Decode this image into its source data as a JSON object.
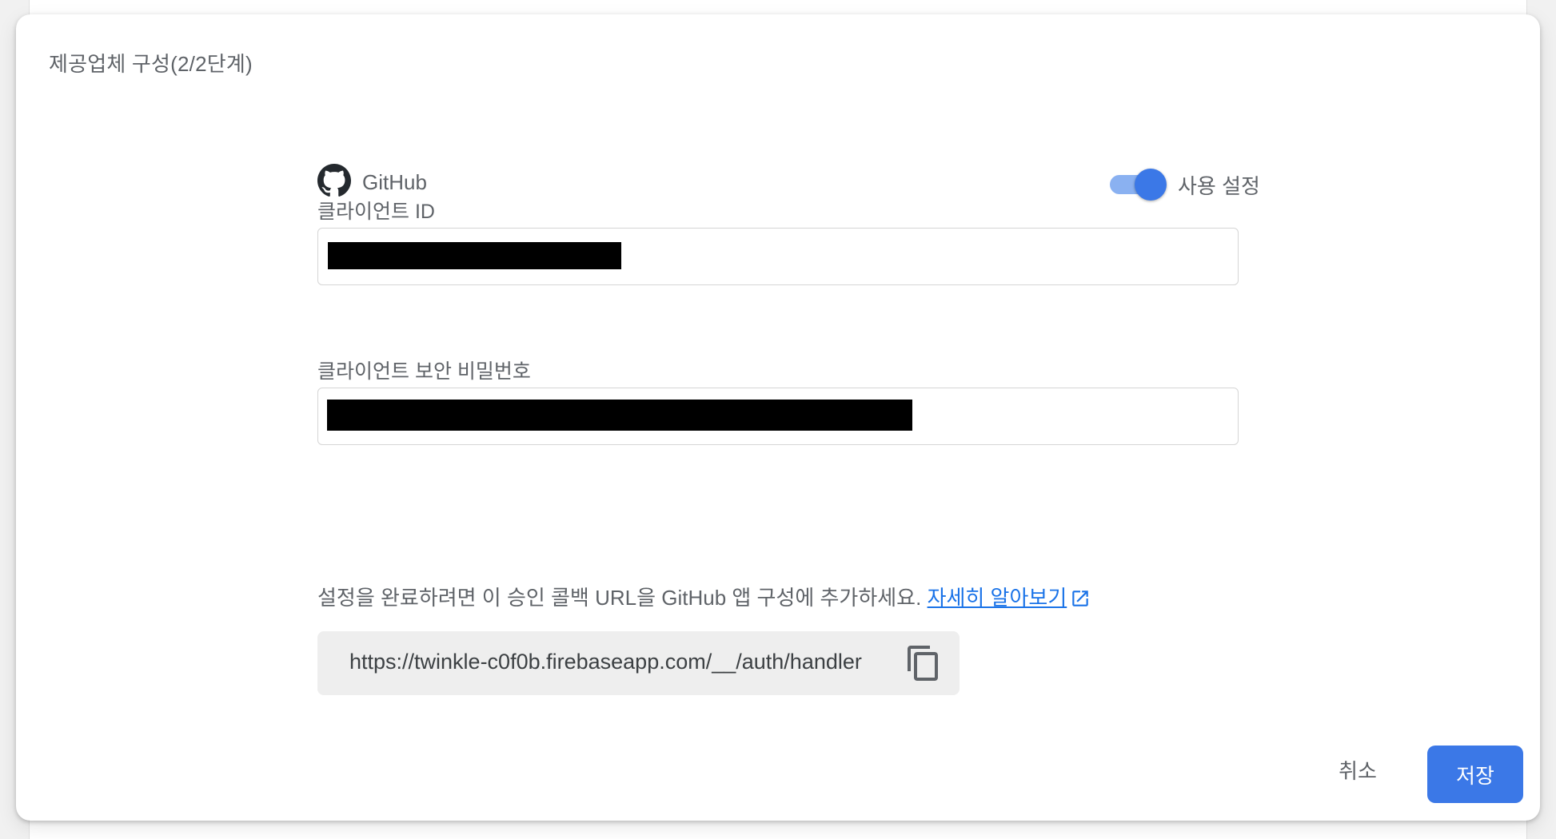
{
  "dialog": {
    "title": "제공업체 구성(2/2단계)"
  },
  "provider": {
    "icon": "github-icon",
    "name": "GitHub",
    "enabled": true,
    "toggle_label": "사용 설정"
  },
  "fields": {
    "client_id_label": "클라이언트 ID",
    "client_secret_label": "클라이언트 보안 비밀번호"
  },
  "callback": {
    "note": "설정을 완료하려면 이 승인 콜백 URL을 GitHub 앱 구성에 추가하세요.",
    "learn_more": "자세히 알아보기",
    "url": "https://twinkle-c0f0b.firebaseapp.com/__/auth/handler"
  },
  "actions": {
    "cancel": "취소",
    "save": "저장"
  },
  "colors": {
    "primary": "#3b78e7",
    "link": "#1a73e8",
    "toggle_track": "#8ab1f1"
  }
}
